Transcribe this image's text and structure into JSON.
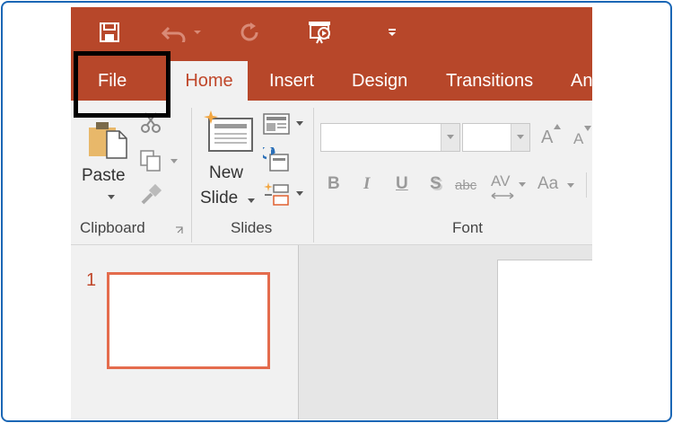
{
  "colors": {
    "accent": "#b7472a",
    "active_tab_text": "#c0472a",
    "ribbon_bg": "#f1f1f1",
    "frame_border": "#1a66b5",
    "slide_selected_border": "#e46c4d"
  },
  "quick_access": {
    "icons": [
      "save-icon",
      "undo-icon",
      "dropdown-caret-icon",
      "redo-icon",
      "present-icon",
      "customize-caret-icon"
    ]
  },
  "tabs": {
    "file": "File",
    "home": "Home",
    "insert": "Insert",
    "design": "Design",
    "transitions": "Transitions",
    "animations": "An"
  },
  "ribbon": {
    "clipboard": {
      "paste_label": "Paste",
      "group_label": "Clipboard"
    },
    "slides": {
      "new_slide_line1": "New",
      "new_slide_line2": "Slide",
      "group_label": "Slides"
    },
    "font": {
      "group_label": "Font",
      "font_name_value": "",
      "font_size_value": "",
      "grow_label": "A",
      "shrink_label": "A",
      "bold_label": "B",
      "italic_label": "I",
      "underline_label": "U",
      "shadow_label": "S",
      "strike_label": "abc",
      "spacing_label": "AV",
      "case_label": "Aa"
    }
  },
  "slides_pane": {
    "items": [
      {
        "number": "1"
      }
    ]
  }
}
